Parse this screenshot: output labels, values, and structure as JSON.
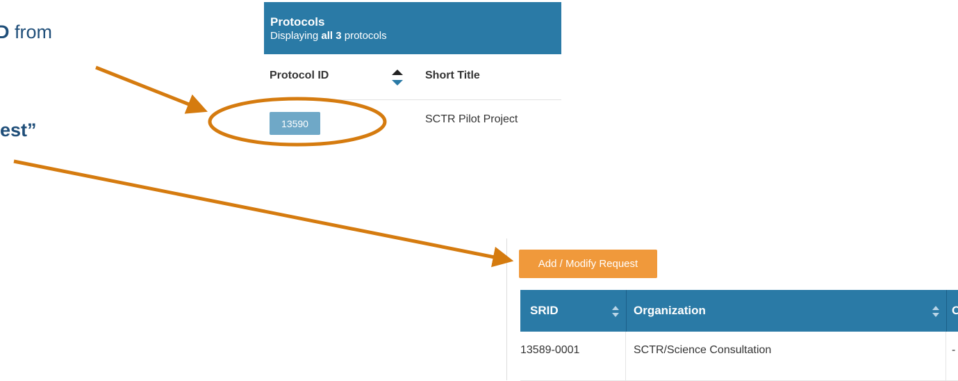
{
  "callouts": {
    "line1_bold": "D",
    "line1_rest": " from",
    "line2": "est”"
  },
  "protocols": {
    "title": "Protocols",
    "subtitle_prefix": "Displaying ",
    "subtitle_bold": "all 3",
    "subtitle_suffix": " protocols",
    "columns": [
      "Protocol ID",
      "Short Title"
    ],
    "rows": [
      {
        "id": "13590",
        "short_title": "SCTR Pilot Project"
      }
    ]
  },
  "requests": {
    "add_button": "Add / Modify Request",
    "columns": [
      "SRID",
      "Organization",
      "O"
    ],
    "rows": [
      {
        "srid": "13589-0001",
        "organization": "SCTR/Science Consultation",
        "other": "-"
      }
    ]
  },
  "colors": {
    "header_blue": "#2a7aa6",
    "callout_orange": "#d57b0f",
    "button_orange": "#f0993b",
    "id_button": "#6fa8c7"
  },
  "icons": [
    "sort-arrows-icon"
  ]
}
